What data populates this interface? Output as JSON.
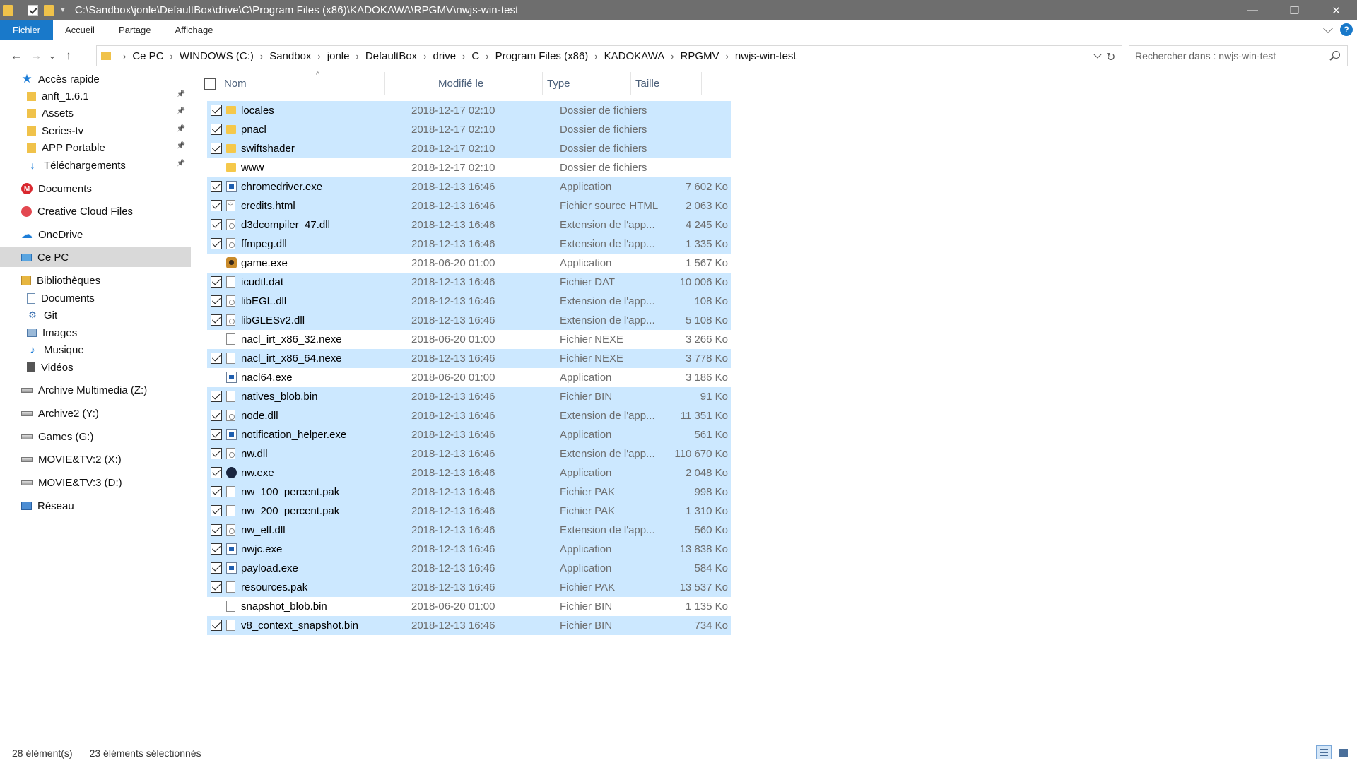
{
  "window": {
    "title": "C:\\Sandbox\\jonle\\DefaultBox\\drive\\C\\Program Files (x86)\\KADOKAWA\\RPGMV\\nwjs-win-test",
    "controls": {
      "minimize": "—",
      "maximize": "❐",
      "close": "✕"
    }
  },
  "ribbon": {
    "tabs": [
      "Fichier",
      "Accueil",
      "Partage",
      "Affichage"
    ],
    "help_label": "?"
  },
  "nav": {
    "back": "←",
    "forward": "→",
    "recent": "⌄",
    "up": "↑",
    "refresh": "↻"
  },
  "address": {
    "crumbs": [
      "Ce PC",
      "WINDOWS (C:)",
      "Sandbox",
      "jonle",
      "DefaultBox",
      "drive",
      "C",
      "Program Files (x86)",
      "KADOKAWA",
      "RPGMV",
      "nwjs-win-test"
    ]
  },
  "search": {
    "placeholder": "Rechercher dans : nwjs-win-test"
  },
  "sidebar": {
    "items": [
      {
        "label": "Accès rapide",
        "icon": "star-icon"
      },
      {
        "label": "anft_1.6.1",
        "icon": "folder-icon",
        "pinned": true
      },
      {
        "label": "Assets",
        "icon": "folder-icon",
        "pinned": true
      },
      {
        "label": "Series-tv",
        "icon": "folder-icon",
        "pinned": true
      },
      {
        "label": "APP Portable",
        "icon": "folder-icon",
        "pinned": true
      },
      {
        "label": "Téléchargements",
        "icon": "download-icon",
        "pinned": true
      },
      {
        "label": "Documents",
        "icon": "mega-icon"
      },
      {
        "label": "Creative Cloud Files",
        "icon": "creative-cloud-icon"
      },
      {
        "label": "OneDrive",
        "icon": "cloud-icon"
      },
      {
        "label": "Ce PC",
        "icon": "computer-icon",
        "selected": true
      },
      {
        "label": "Bibliothèques",
        "icon": "library-icon"
      },
      {
        "label": "Documents",
        "icon": "document-icon"
      },
      {
        "label": "Git",
        "icon": "git-icon"
      },
      {
        "label": "Images",
        "icon": "image-icon"
      },
      {
        "label": "Musique",
        "icon": "music-icon"
      },
      {
        "label": "Vidéos",
        "icon": "video-icon"
      },
      {
        "label": "Archive Multimedia (Z:)",
        "icon": "drive-icon"
      },
      {
        "label": "Archive2 (Y:)",
        "icon": "drive-icon"
      },
      {
        "label": "Games (G:)",
        "icon": "drive-icon"
      },
      {
        "label": "MOVIE&TV:2 (X:)",
        "icon": "drive-icon"
      },
      {
        "label": "MOVIE&TV:3 (D:)",
        "icon": "drive-icon"
      },
      {
        "label": "Réseau",
        "icon": "network-icon"
      }
    ]
  },
  "columns": {
    "name": "Nom",
    "modified": "Modifié le",
    "type": "Type",
    "size": "Taille"
  },
  "files": [
    {
      "name": "locales",
      "date": "2018-12-17 02:10",
      "type": "Dossier de fichiers",
      "size": "",
      "icon": "folder",
      "checked": true
    },
    {
      "name": "pnacl",
      "date": "2018-12-17 02:10",
      "type": "Dossier de fichiers",
      "size": "",
      "icon": "folder",
      "checked": true
    },
    {
      "name": "swiftshader",
      "date": "2018-12-17 02:10",
      "type": "Dossier de fichiers",
      "size": "",
      "icon": "folder",
      "checked": true
    },
    {
      "name": "www",
      "date": "2018-12-17 02:10",
      "type": "Dossier de fichiers",
      "size": "",
      "icon": "folder",
      "checked": false
    },
    {
      "name": "chromedriver.exe",
      "date": "2018-12-13 16:46",
      "type": "Application",
      "size": "7 602 Ko",
      "icon": "exe",
      "checked": true
    },
    {
      "name": "credits.html",
      "date": "2018-12-13 16:46",
      "type": "Fichier source HTML",
      "size": "2 063 Ko",
      "icon": "html",
      "checked": true
    },
    {
      "name": "d3dcompiler_47.dll",
      "date": "2018-12-13 16:46",
      "type": "Extension de l'app...",
      "size": "4 245 Ko",
      "icon": "dll",
      "checked": true
    },
    {
      "name": "ffmpeg.dll",
      "date": "2018-12-13 16:46",
      "type": "Extension de l'app...",
      "size": "1 335 Ko",
      "icon": "dll",
      "checked": true
    },
    {
      "name": "game.exe",
      "date": "2018-06-20 01:00",
      "type": "Application",
      "size": "1 567 Ko",
      "icon": "game",
      "checked": false
    },
    {
      "name": "icudtl.dat",
      "date": "2018-12-13 16:46",
      "type": "Fichier DAT",
      "size": "10 006 Ko",
      "icon": "file",
      "checked": true
    },
    {
      "name": "libEGL.dll",
      "date": "2018-12-13 16:46",
      "type": "Extension de l'app...",
      "size": "108 Ko",
      "icon": "dll",
      "checked": true
    },
    {
      "name": "libGLESv2.dll",
      "date": "2018-12-13 16:46",
      "type": "Extension de l'app...",
      "size": "5 108 Ko",
      "icon": "dll",
      "checked": true
    },
    {
      "name": "nacl_irt_x86_32.nexe",
      "date": "2018-06-20 01:00",
      "type": "Fichier NEXE",
      "size": "3 266 Ko",
      "icon": "file",
      "checked": false
    },
    {
      "name": "nacl_irt_x86_64.nexe",
      "date": "2018-12-13 16:46",
      "type": "Fichier NEXE",
      "size": "3 778 Ko",
      "icon": "file",
      "checked": true
    },
    {
      "name": "nacl64.exe",
      "date": "2018-06-20 01:00",
      "type": "Application",
      "size": "3 186 Ko",
      "icon": "exe",
      "checked": false
    },
    {
      "name": "natives_blob.bin",
      "date": "2018-12-13 16:46",
      "type": "Fichier BIN",
      "size": "91 Ko",
      "icon": "file",
      "checked": true
    },
    {
      "name": "node.dll",
      "date": "2018-12-13 16:46",
      "type": "Extension de l'app...",
      "size": "11 351 Ko",
      "icon": "dll",
      "checked": true
    },
    {
      "name": "notification_helper.exe",
      "date": "2018-12-13 16:46",
      "type": "Application",
      "size": "561 Ko",
      "icon": "exe",
      "checked": true
    },
    {
      "name": "nw.dll",
      "date": "2018-12-13 16:46",
      "type": "Extension de l'app...",
      "size": "110 670 Ko",
      "icon": "dll",
      "checked": true
    },
    {
      "name": "nw.exe",
      "date": "2018-12-13 16:46",
      "type": "Application",
      "size": "2 048 Ko",
      "icon": "nw",
      "checked": true
    },
    {
      "name": "nw_100_percent.pak",
      "date": "2018-12-13 16:46",
      "type": "Fichier PAK",
      "size": "998 Ko",
      "icon": "file",
      "checked": true
    },
    {
      "name": "nw_200_percent.pak",
      "date": "2018-12-13 16:46",
      "type": "Fichier PAK",
      "size": "1 310 Ko",
      "icon": "file",
      "checked": true
    },
    {
      "name": "nw_elf.dll",
      "date": "2018-12-13 16:46",
      "type": "Extension de l'app...",
      "size": "560 Ko",
      "icon": "dll",
      "checked": true
    },
    {
      "name": "nwjc.exe",
      "date": "2018-12-13 16:46",
      "type": "Application",
      "size": "13 838 Ko",
      "icon": "exe",
      "checked": true
    },
    {
      "name": "payload.exe",
      "date": "2018-12-13 16:46",
      "type": "Application",
      "size": "584 Ko",
      "icon": "exe",
      "checked": true
    },
    {
      "name": "resources.pak",
      "date": "2018-12-13 16:46",
      "type": "Fichier PAK",
      "size": "13 537 Ko",
      "icon": "file",
      "checked": true
    },
    {
      "name": "snapshot_blob.bin",
      "date": "2018-06-20 01:00",
      "type": "Fichier BIN",
      "size": "1 135 Ko",
      "icon": "file",
      "checked": false
    },
    {
      "name": "v8_context_snapshot.bin",
      "date": "2018-12-13 16:46",
      "type": "Fichier BIN",
      "size": "734 Ko",
      "icon": "file",
      "checked": true
    }
  ],
  "status": {
    "count": "28 élément(s)",
    "selected": "23 éléments sélectionnés"
  },
  "colors": {
    "accent": "#1979ca",
    "selection": "#cce8ff",
    "titlebar": "#6e6e6e"
  }
}
